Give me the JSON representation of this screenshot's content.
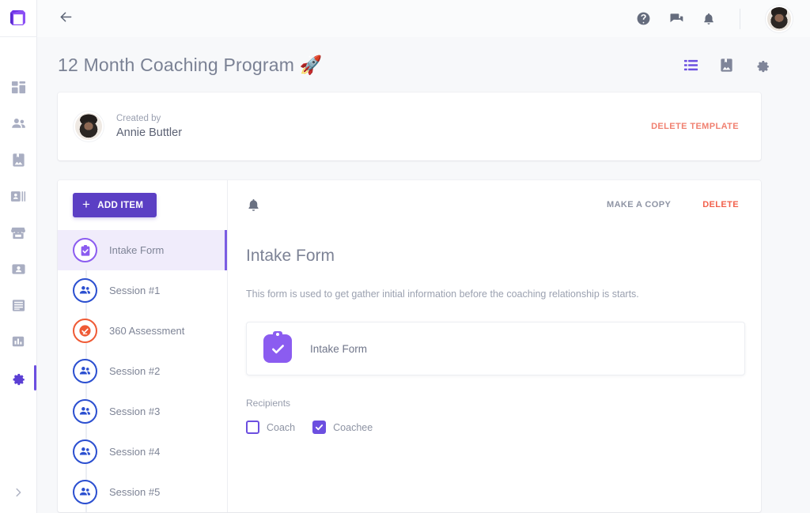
{
  "brand": {
    "logo_icon": "cube-logo-icon",
    "accent_color": "#6c4fe0",
    "danger_color": "#f2614c"
  },
  "rail": {
    "items": [
      {
        "icon": "dashboard-icon",
        "name": "sidebar-item-dashboard",
        "active": false
      },
      {
        "icon": "people-icon",
        "name": "sidebar-item-clients",
        "active": false
      },
      {
        "icon": "image-card-icon",
        "name": "sidebar-item-media",
        "active": false
      },
      {
        "icon": "contact-list-icon",
        "name": "sidebar-item-contacts",
        "active": false
      },
      {
        "icon": "storefront-icon",
        "name": "sidebar-item-store",
        "active": false
      },
      {
        "icon": "id-card-icon",
        "name": "sidebar-item-profile",
        "active": false
      },
      {
        "icon": "document-icon",
        "name": "sidebar-item-documents",
        "active": false
      },
      {
        "icon": "bar-chart-icon",
        "name": "sidebar-item-reports",
        "active": false
      },
      {
        "icon": "gear-icon",
        "name": "sidebar-item-settings",
        "active": true
      }
    ],
    "expand_icon": "chevron-right-icon"
  },
  "topbar": {
    "back_icon": "arrow-left-icon",
    "icons": [
      {
        "icon": "help-circle-icon",
        "name": "help-icon"
      },
      {
        "icon": "chat-bubbles-icon",
        "name": "messages-icon"
      },
      {
        "icon": "bell-icon",
        "name": "notifications-icon"
      }
    ],
    "avatar_name": "user-avatar"
  },
  "page": {
    "title": "12 Month Coaching Program 🚀",
    "view_icons": [
      {
        "icon": "list-view-icon",
        "name": "list-view-icon",
        "accent": true
      },
      {
        "icon": "cover-image-icon",
        "name": "cover-image-icon",
        "accent": false
      },
      {
        "icon": "gear-icon",
        "name": "program-settings-icon",
        "accent": false
      }
    ]
  },
  "creator": {
    "label": "Created by",
    "name": "Annie Buttler",
    "delete_template_label": "DELETE TEMPLATE"
  },
  "itemlist": {
    "add_item_label": "ADD ITEM",
    "items": [
      {
        "label": "Intake Form",
        "icon": "clipboard-check-icon",
        "color": "purple",
        "active": true
      },
      {
        "label": "Session #1",
        "icon": "people-icon",
        "color": "blue",
        "active": false
      },
      {
        "label": "360 Assessment",
        "icon": "check-circle-icon",
        "color": "orange",
        "active": false
      },
      {
        "label": "Session #2",
        "icon": "people-icon",
        "color": "blue",
        "active": false
      },
      {
        "label": "Session #3",
        "icon": "people-icon",
        "color": "blue",
        "active": false
      },
      {
        "label": "Session #4",
        "icon": "people-icon",
        "color": "blue",
        "active": false
      },
      {
        "label": "Session #5",
        "icon": "people-icon",
        "color": "blue",
        "active": false
      }
    ]
  },
  "detail": {
    "bell_icon": "reminder-bell-icon",
    "make_copy_label": "MAKE A COPY",
    "delete_label": "DELETE",
    "title": "Intake Form",
    "description": "This form is used to get gather initial information before the coaching relationship is starts.",
    "form_card": {
      "icon": "clipboard-check-icon",
      "name": "Intake Form"
    },
    "recipients_label": "Recipients",
    "recipients": [
      {
        "label": "Coach",
        "checked": false
      },
      {
        "label": "Coachee",
        "checked": true
      }
    ]
  }
}
